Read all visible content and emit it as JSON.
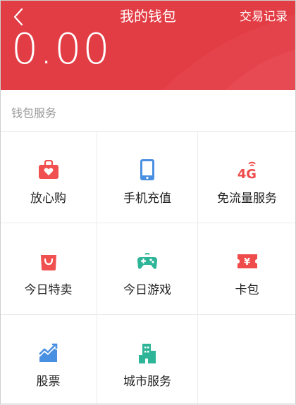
{
  "header": {
    "title": "我的钱包",
    "transactions_link": "交易记录",
    "back_icon": "chevron-left-icon",
    "background_color": "#e23c44"
  },
  "balance": {
    "amount": "0.00"
  },
  "wallet_services": {
    "section_title": "钱包服务",
    "items": [
      {
        "label": "放心购",
        "icon": "shopping-bag-heart-icon",
        "color": "#f0504f"
      },
      {
        "label": "手机充值",
        "icon": "mobile-phone-icon",
        "color": "#4a90e2"
      },
      {
        "label": "免流量服务",
        "icon": "4g-icon",
        "icon_text": "4G",
        "color": "#ef4b4b"
      },
      {
        "label": "今日特卖",
        "icon": "shopping-bag-icon",
        "color": "#f0504f"
      },
      {
        "label": "今日游戏",
        "icon": "gamepad-icon",
        "color": "#2eb598"
      },
      {
        "label": "卡包",
        "icon": "coupon-icon",
        "icon_text": "¥",
        "color": "#ef4b4b"
      },
      {
        "label": "股票",
        "icon": "stock-chart-icon",
        "color": "#4a90e2"
      },
      {
        "label": "城市服务",
        "icon": "city-buildings-icon",
        "color": "#2eb598"
      }
    ]
  }
}
